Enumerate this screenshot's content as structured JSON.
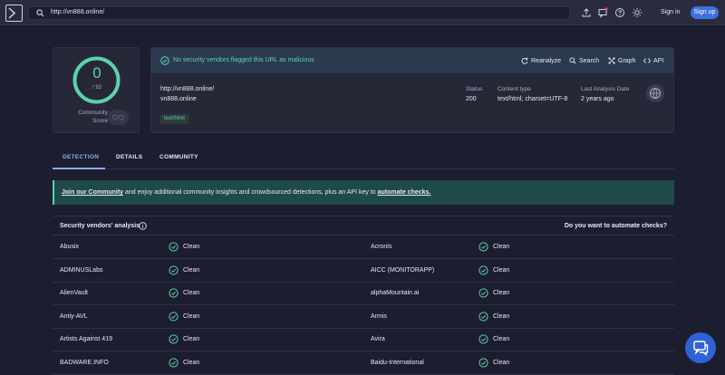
{
  "topbar": {
    "url": "http://vn888.online/",
    "signin_label": "Sign in",
    "signup_label": "Sign up"
  },
  "score": {
    "value": "0",
    "total": "/ 93",
    "community_label_1": "Community",
    "community_label_2": "Score"
  },
  "summary": {
    "verdict": "No security vendors flagged this URL as malicious",
    "actions": [
      "Reanalyze",
      "Search",
      "Graph",
      "API"
    ],
    "url": "http://vn888.online/",
    "host": "vn888.online",
    "tag": "text/html",
    "status_label": "Status",
    "status_value": "200",
    "content_type_label": "Content type",
    "content_type_value": "text/html; charset=UTF-8",
    "last_analysis_label": "Last Analysis Date",
    "last_analysis_value": "2 years ago"
  },
  "tabs": [
    "DETECTION",
    "DETAILS",
    "COMMUNITY"
  ],
  "banner": {
    "link1": "Join our Community",
    "middle": " and enjoy additional community insights and crowdsourced detections, plus an API key to ",
    "link2": "automate checks."
  },
  "table": {
    "title": "Security vendors' analysis",
    "right_text": "Do you want to automate checks?",
    "rows": [
      {
        "left_vendor": "Abusix",
        "left_result": "Clean",
        "right_vendor": "Acronis",
        "right_result": "Clean"
      },
      {
        "left_vendor": "ADMINUSLabs",
        "left_result": "Clean",
        "right_vendor": "AICC (MONITORAPP)",
        "right_result": "Clean"
      },
      {
        "left_vendor": "AlienVault",
        "left_result": "Clean",
        "right_vendor": "alphaMountain.ai",
        "right_result": "Clean"
      },
      {
        "left_vendor": "Antiy-AVL",
        "left_result": "Clean",
        "right_vendor": "Armis",
        "right_result": "Clean"
      },
      {
        "left_vendor": "Artists Against 419",
        "left_result": "Clean",
        "right_vendor": "Avira",
        "right_result": "Clean"
      },
      {
        "left_vendor": "BADWARE.INFO",
        "left_result": "Clean",
        "right_vendor": "Baidu-International",
        "right_result": "Clean"
      }
    ]
  },
  "colors": {
    "accent_green": "#5bd3ad",
    "accent_blue": "#3b70e0",
    "tab_active": "#8eaaf5",
    "background": "#1c1d2e"
  },
  "icons": [
    "virustotal-logo-icon",
    "search-icon",
    "upload-icon",
    "flag-icon",
    "help-icon",
    "theme-icon",
    "refresh-icon",
    "graph-icon",
    "api-icon",
    "check-circle-icon",
    "info-icon",
    "chat-icon"
  ]
}
